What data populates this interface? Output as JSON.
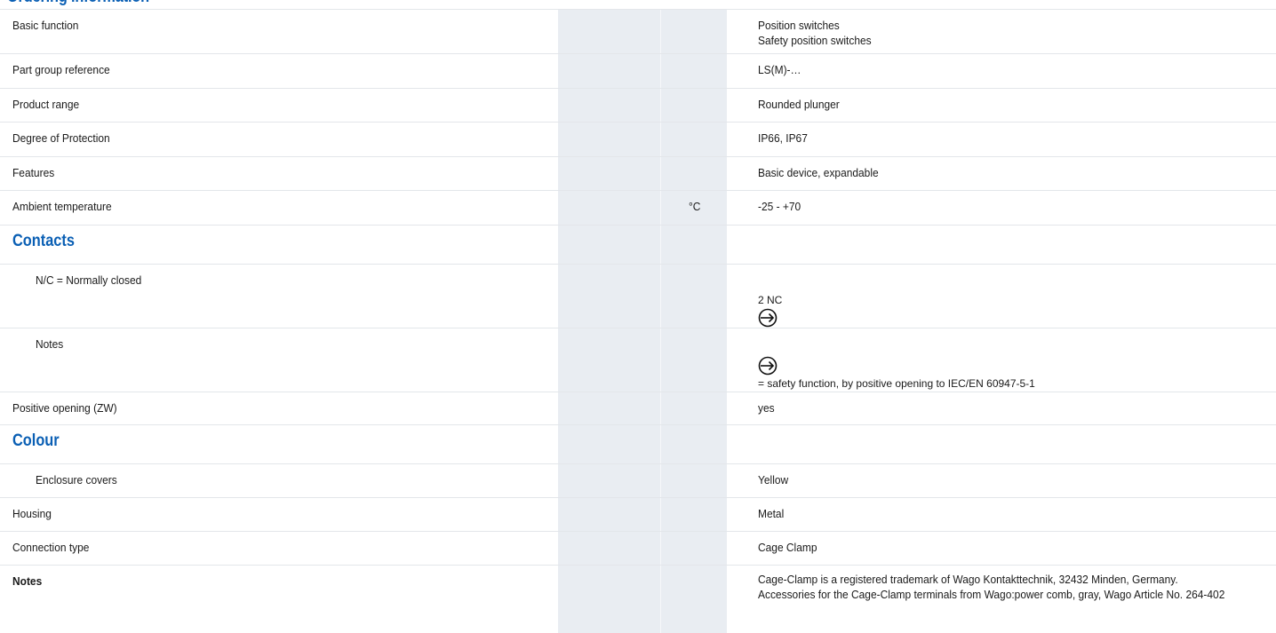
{
  "section_heading_partial": "Ordering information",
  "rows": [
    {
      "label": "Basic function",
      "unit": "",
      "value": "Position switches\nSafety position switches"
    },
    {
      "label": "Part group reference",
      "unit": "",
      "value": "LS(M)-…"
    },
    {
      "label": "Product range",
      "unit": "",
      "value": "Rounded plunger"
    },
    {
      "label": "Degree of Protection",
      "unit": "",
      "value": "IP66, IP67"
    },
    {
      "label": "Features",
      "unit": "",
      "value": "Basic device, expandable"
    },
    {
      "label": "Ambient temperature",
      "unit": "°C",
      "value": "-25 - +70"
    }
  ],
  "contacts": {
    "heading": "Contacts",
    "nc_label": "N/C = Normally closed",
    "nc_value": "2 NC",
    "notes_label": "Notes",
    "notes_value": "= safety function, by positive opening to IEC/EN 60947-5-1",
    "positive_label": "Positive opening (ZW)",
    "positive_value": "yes"
  },
  "colour": {
    "heading": "Colour",
    "enclosure_label": "Enclosure covers",
    "enclosure_value": "Yellow"
  },
  "rows2": [
    {
      "label": "Housing",
      "value": "Metal"
    },
    {
      "label": "Connection type",
      "value": "Cage Clamp"
    }
  ],
  "notes": {
    "label": "Notes",
    "value": "Cage-Clamp is a registered trademark of Wago Kontakttechnik, 32432 Minden, Germany.\nAccessories for the Cage-Clamp terminals from Wago:power comb, gray, Wago Article No. 264-402"
  },
  "icons": {
    "safety": "positive-opening-safety-icon"
  },
  "colors": {
    "accent": "#0a5fb4",
    "shade": "#e9edf2",
    "rule": "#e3e6ea"
  }
}
